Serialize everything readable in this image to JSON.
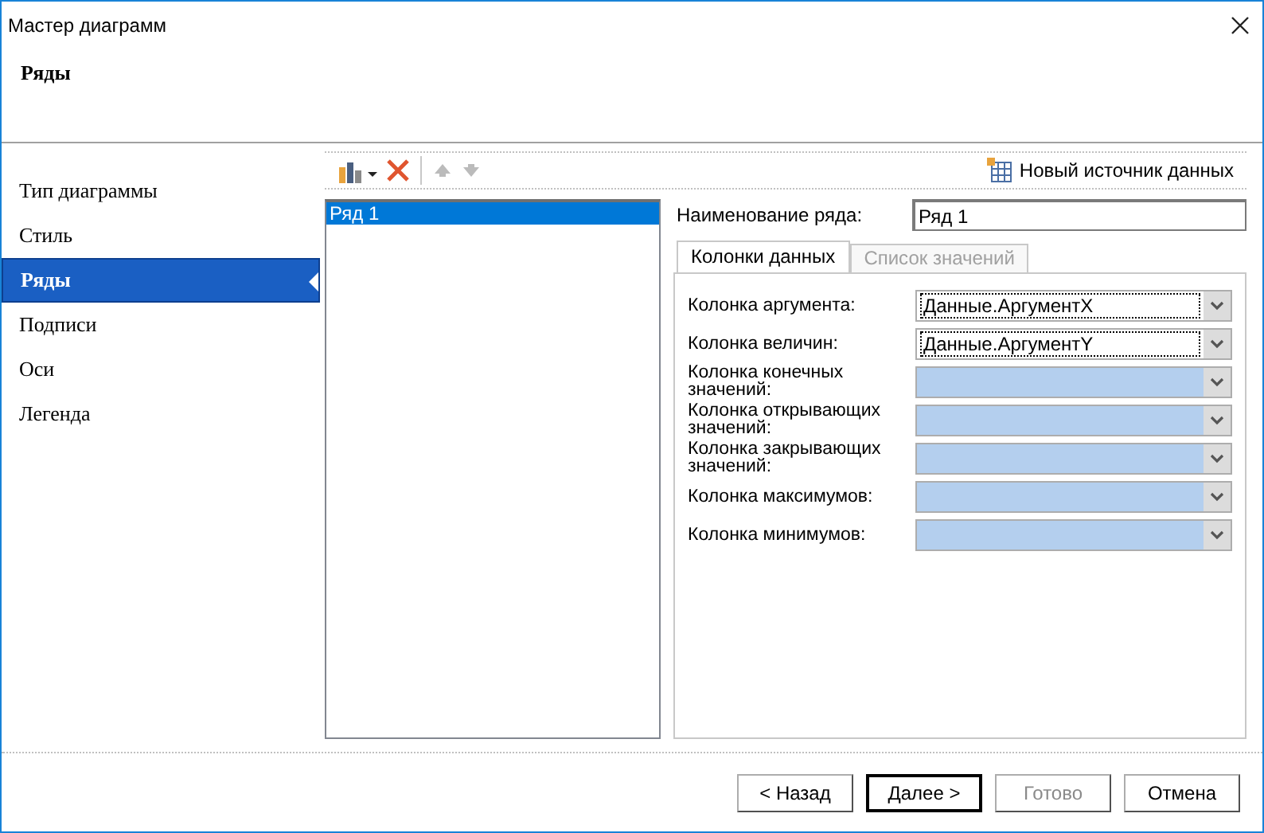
{
  "window": {
    "title": "Мастер диаграмм"
  },
  "header": {
    "title": "Ряды"
  },
  "sidebar": {
    "items": [
      {
        "label": "Тип диаграммы",
        "selected": false
      },
      {
        "label": "Стиль",
        "selected": false
      },
      {
        "label": "Ряды",
        "selected": true
      },
      {
        "label": "Подписи",
        "selected": false
      },
      {
        "label": "Оси",
        "selected": false
      },
      {
        "label": "Легенда",
        "selected": false
      }
    ]
  },
  "toolbar": {
    "new_source": "Новый источник данных"
  },
  "series_list": [
    {
      "label": "Ряд 1",
      "selected": true
    }
  ],
  "series_name": {
    "label": "Наименование ряда:",
    "value": "Ряд 1"
  },
  "tabs": [
    {
      "label": "Колонки данных",
      "selected": true,
      "disabled": false
    },
    {
      "label": "Список значений",
      "selected": false,
      "disabled": true
    }
  ],
  "columns": [
    {
      "label": "Колонка аргумента:",
      "value": "Данные.АргументX",
      "disabled": false
    },
    {
      "label": "Колонка величин:",
      "value": "Данные.АргументY",
      "disabled": false
    },
    {
      "label": "Колонка конечных значений:",
      "disabled": true
    },
    {
      "label": "Колонка открывающих значений:",
      "disabled": true
    },
    {
      "label": "Колонка закрывающих значений:",
      "disabled": true
    },
    {
      "label": "Колонка максимумов:",
      "disabled": true
    },
    {
      "label": "Колонка минимумов:",
      "disabled": true
    }
  ],
  "buttons": [
    {
      "label": "< Назад",
      "disabled": false,
      "default": false
    },
    {
      "label": "Далее >",
      "disabled": false,
      "default": true
    },
    {
      "label": "Готово",
      "disabled": true,
      "default": false
    },
    {
      "label": "Отмена",
      "disabled": false,
      "default": false
    }
  ]
}
